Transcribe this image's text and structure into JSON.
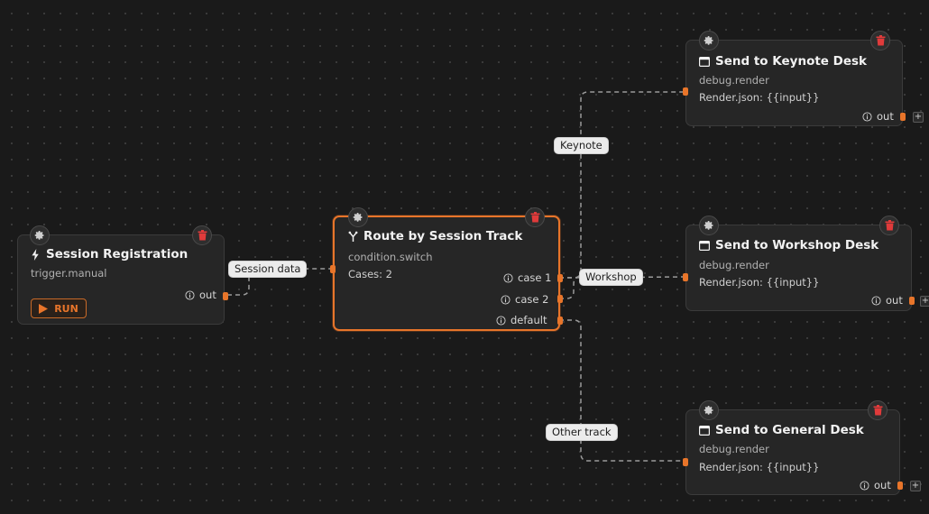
{
  "nodes": {
    "session_registration": {
      "title": "Session Registration",
      "subtitle": "trigger.manual",
      "run_label": "RUN",
      "out_label": "out"
    },
    "route": {
      "title": "Route by Session Track",
      "subtitle": "condition.switch",
      "cases": "Cases: 2",
      "case1_label": "case 1",
      "case2_label": "case 2",
      "default_label": "default"
    },
    "keynote": {
      "title": "Send to Keynote Desk",
      "subtitle": "debug.render",
      "render": "Render.json: {{input}}",
      "out_label": "out",
      "plus": "+"
    },
    "workshop": {
      "title": "Send to Workshop Desk",
      "subtitle": "debug.render",
      "render": "Render.json: {{input}}",
      "out_label": "out",
      "plus": "+"
    },
    "general": {
      "title": "Send to General Desk",
      "subtitle": "debug.render",
      "render": "Render.json: {{input}}",
      "out_label": "out",
      "plus": "+"
    }
  },
  "edge_labels": {
    "session_data": "Session data",
    "keynote": "Keynote",
    "workshop": "Workshop",
    "other_track": "Other track"
  },
  "colors": {
    "accent": "#e8752a",
    "delete": "#e03b3b",
    "canvas": "#1a1a1a",
    "node_bg": "#262626"
  },
  "icons": {
    "settings": "gear-icon",
    "delete": "trash-icon",
    "trigger": "lightning-icon",
    "switch": "branch-icon",
    "render": "window-icon",
    "info": "info-icon",
    "play": "play-icon"
  }
}
